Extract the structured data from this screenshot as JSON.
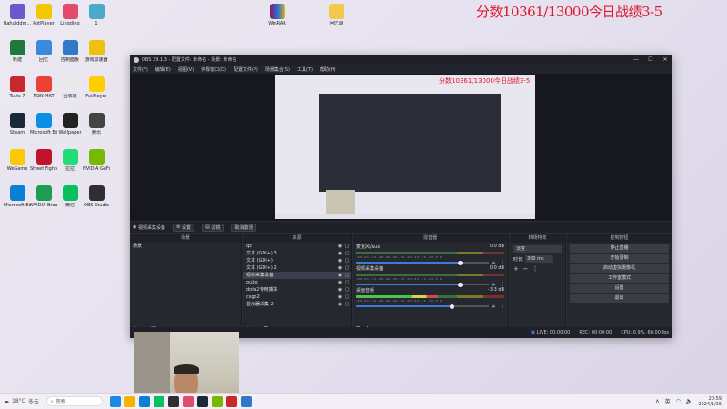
{
  "overlay": {
    "score_text": "分数10361/13000今日战绩3-5"
  },
  "desktop": {
    "icons": [
      {
        "label": "Rahulddm...",
        "color": "#6a5acd"
      },
      {
        "label": "PotPlayer",
        "color": "#f2c600"
      },
      {
        "label": "Lingding",
        "color": "#e24a6e"
      },
      {
        "label": "1",
        "color": "#4aa8c9"
      },
      {
        "label": "新建",
        "color": "#1e7a3c"
      },
      {
        "label": "回忆",
        "color": "#3a8ae0"
      },
      {
        "label": "控制面板",
        "color": "#2f79c8"
      },
      {
        "label": "游戏加速器",
        "color": "#f0c010"
      },
      {
        "label": "Tools 7",
        "color": "#c8282d"
      },
      {
        "label": "MSN MKT",
        "color": "#ea4335"
      },
      {
        "label": "回收站",
        "color": "#e9e9e9"
      },
      {
        "label": "PotPlayer",
        "color": "#ffcd00"
      },
      {
        "label": "Steam",
        "color": "#1b2838"
      },
      {
        "label": "Microsoft Edge",
        "color": "#0c8ee7"
      },
      {
        "label": "Wallpaper",
        "color": "#222"
      },
      {
        "label": "腾讯",
        "color": "#444"
      },
      {
        "label": "WeGame",
        "color": "#fbca04"
      },
      {
        "label": "Street Fighter 6",
        "color": "#c0142a"
      },
      {
        "label": "拉拉",
        "color": "#2d7"
      },
      {
        "label": "NVIDIA GeForce",
        "color": "#76b900"
      },
      {
        "label": "Microsoft Edge",
        "color": "#0a7fd5"
      },
      {
        "label": "NVIDIA Broadcast",
        "color": "#1e9e54"
      },
      {
        "label": "微信",
        "color": "#07c160"
      },
      {
        "label": "OBS Studio",
        "color": "#302e31"
      }
    ],
    "folders": [
      {
        "label": "WinRAR"
      },
      {
        "label": "回忆录"
      }
    ]
  },
  "obs": {
    "title": "OBS 29.1.3 - 配置文件: 未命名 - 场景: 未命名",
    "menu": [
      "文件(F)",
      "编辑(E)",
      "视图(V)",
      "停靠窗口(D)",
      "配置文件(P)",
      "场景集合(S)",
      "工具(T)",
      "帮助(H)"
    ],
    "source_bar": {
      "current_source": "视频采集设备",
      "settings": "设置",
      "filters": "滤镜",
      "deactivate": "取消激活"
    },
    "docks": {
      "scenes_title": "场景",
      "sources_title": "来源",
      "mixer_title": "混音器",
      "transitions_title": "转场特效",
      "controls_title": "控制按钮"
    },
    "scenes": [
      "场景"
    ],
    "sources": [
      {
        "name": "qz",
        "selected": false
      },
      {
        "name": "文本 (GDI+) 3",
        "selected": false
      },
      {
        "name": "文本 (GDI+)",
        "selected": false
      },
      {
        "name": "文本 (GDI+) 2",
        "selected": false
      },
      {
        "name": "视频采集设备",
        "selected": true
      },
      {
        "name": "pubg",
        "selected": false
      },
      {
        "name": "dota2专用捕获",
        "selected": false
      },
      {
        "name": "csgo2",
        "selected": false
      },
      {
        "name": "显示器采集 2",
        "selected": false
      }
    ],
    "mixer": [
      {
        "name": "麦克风/Aux",
        "db": "0.0 dB",
        "level": 0.0,
        "volume": 0.78
      },
      {
        "name": "视频采集设备",
        "db": "0.0 dB",
        "level": 0.0,
        "volume": 0.78
      },
      {
        "name": "桌面音频",
        "db": "-3.3 dB",
        "level": 0.55,
        "volume": 0.72
      }
    ],
    "meter_ticks": "-60 -55 -50 -45 -40 -35 -30 -25 -20 -15 -10 -5 0",
    "transitions": {
      "type": "淡变",
      "duration_label": "时长",
      "duration": "300 ms"
    },
    "controls": [
      "停止直播",
      "开始录制",
      "启动虚拟摄像机",
      "工作室模式",
      "设置",
      "退出"
    ],
    "status": {
      "live": "LIVE: 00:00:00",
      "rec": "REC: 00:00:00",
      "cpu": "CPU: 0.9%, 60.00 fps"
    }
  },
  "taskbar": {
    "weather": "18°C",
    "weather_desc": "多云",
    "search_placeholder": "搜索",
    "ime": "英",
    "time": "20:59",
    "date": "2024/1/15"
  }
}
